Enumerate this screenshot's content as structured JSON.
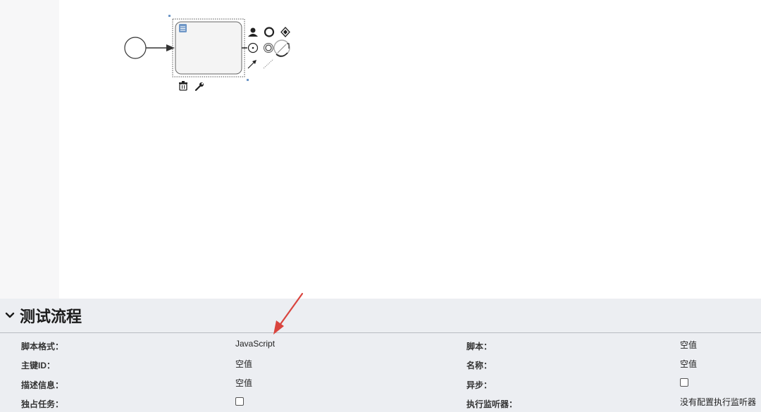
{
  "panel": {
    "title": "测试流程",
    "rows": [
      {
        "left_label": "脚本格式：",
        "left_value": "JavaScript",
        "right_label": "脚本：",
        "right_value": "空值"
      },
      {
        "left_label": "主键ID：",
        "left_value": "空值",
        "right_label": "名称：",
        "right_value": "空值"
      },
      {
        "left_label": "描述信息：",
        "left_value": "空值",
        "right_label": "异步：",
        "right_value_type": "checkbox",
        "right_checked": false
      },
      {
        "left_label": "独占任务：",
        "left_value_type": "checkbox",
        "left_checked": false,
        "right_label": "执行监听器：",
        "right_value": "没有配置执行监听器"
      }
    ]
  },
  "diagram": {
    "elements": [
      "start-event",
      "sequence-flow",
      "script-task"
    ],
    "context_pad_icons": [
      "user-icon",
      "end-event-icon",
      "gateway-icon",
      "intermediate-event-icon",
      "boundary-event-icon",
      "text-annotation-icon",
      "connect-arrow-icon",
      "association-line-icon",
      "trash-icon",
      "wrench-icon"
    ]
  },
  "colors": {
    "accent": "#6f97c7",
    "panel_bg": "#eceef2",
    "annotation_arrow": "#d9443e"
  }
}
